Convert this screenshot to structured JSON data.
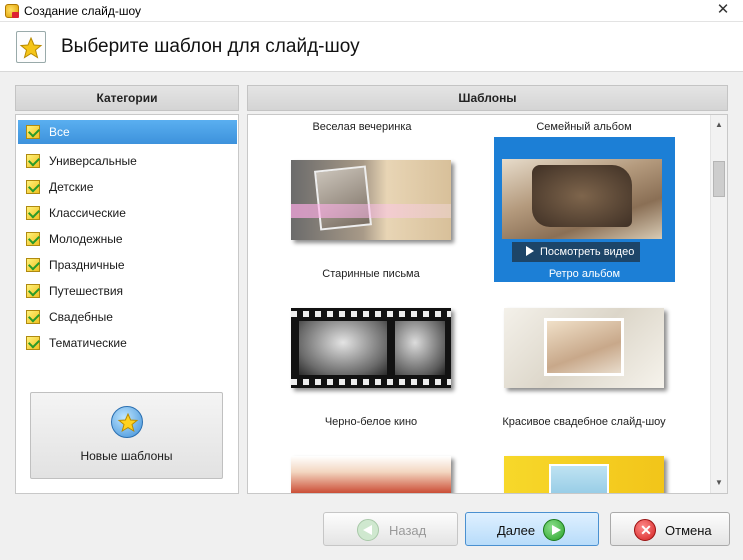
{
  "window": {
    "title": "Создание слайд-шоу",
    "close_glyph": "✕"
  },
  "header": {
    "title": "Выберите шаблон для слайд-шоу"
  },
  "categories": {
    "heading": "Категории",
    "selected_index": 0,
    "items": [
      {
        "label": "Все"
      },
      {
        "label": "Универсальные"
      },
      {
        "label": "Детские"
      },
      {
        "label": "Классические"
      },
      {
        "label": "Молодежные"
      },
      {
        "label": "Праздничные"
      },
      {
        "label": "Путешествия"
      },
      {
        "label": "Свадебные"
      },
      {
        "label": "Тематические"
      }
    ],
    "new_templates_label": "Новые шаблоны"
  },
  "templates": {
    "heading": "Шаблоны",
    "top_captions": [
      "Веселая вечеринка",
      "Семейный альбом"
    ],
    "items": [
      {
        "caption": "Старинные письма"
      },
      {
        "caption": "Ретро альбом",
        "selected": true,
        "preview_label": "Посмотреть видео"
      },
      {
        "caption": "Черно-белое кино"
      },
      {
        "caption": "Красивое свадебное слайд-шоу"
      }
    ]
  },
  "buttons": {
    "back": "Назад",
    "next": "Далее",
    "cancel": "Отмена"
  },
  "colors": {
    "selection": "#1c7fd6",
    "category_selected": "#3d92dc"
  }
}
